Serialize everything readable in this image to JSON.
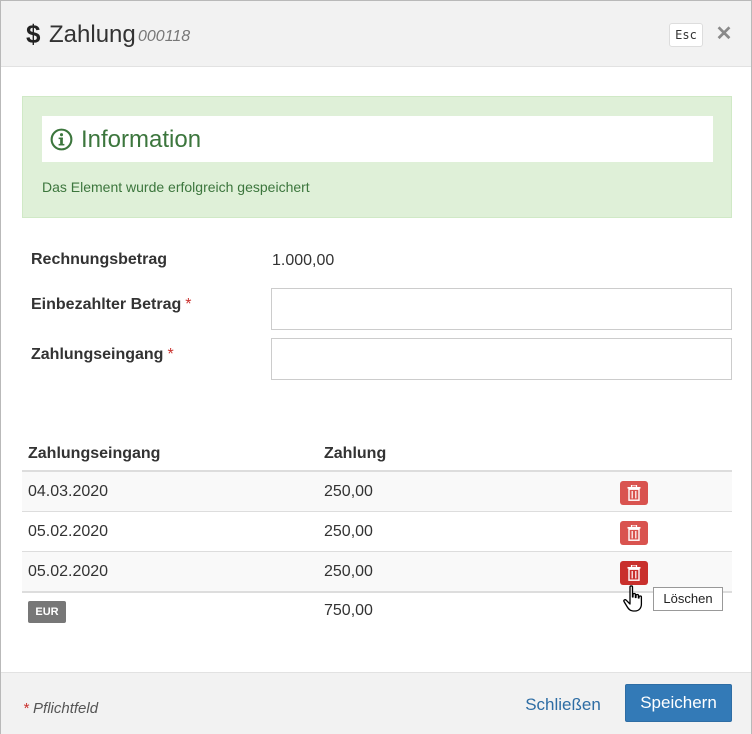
{
  "dialog": {
    "title": "Zahlung",
    "number": "000118",
    "esc_label": "Esc",
    "close_symbol": "✕",
    "title_icon": "dollar-icon"
  },
  "alert": {
    "title": "Information",
    "text": "Das Element wurde erfolgreich gespeichert",
    "icon": "info-circle-icon"
  },
  "form": {
    "invoice_label": "Rechnungsbetrag",
    "invoice_value": "1.000,00",
    "paid_label": "Einbezahlter Betrag",
    "paid_value": "",
    "receipt_label": "Zahlungseingang",
    "receipt_value": "",
    "required_mark": "*"
  },
  "table": {
    "headers": [
      "Zahlungseingang",
      "Zahlung"
    ],
    "rows": [
      {
        "date": "04.03.2020",
        "amount": "250,00"
      },
      {
        "date": "05.02.2020",
        "amount": "250,00"
      },
      {
        "date": "05.02.2020",
        "amount": "250,00"
      }
    ],
    "currency": "EUR",
    "total": "750,00",
    "delete_icon": "trash-icon"
  },
  "tooltip": {
    "text": "Löschen"
  },
  "footer": {
    "required_note": "Pflichtfeld",
    "required_star": "*",
    "close_label": "Schließen",
    "save_label": "Speichern"
  },
  "colors": {
    "primary": "#337ab7",
    "danger": "#d9534f",
    "success_bg": "#dff0d8",
    "success_text": "#3c763d"
  }
}
